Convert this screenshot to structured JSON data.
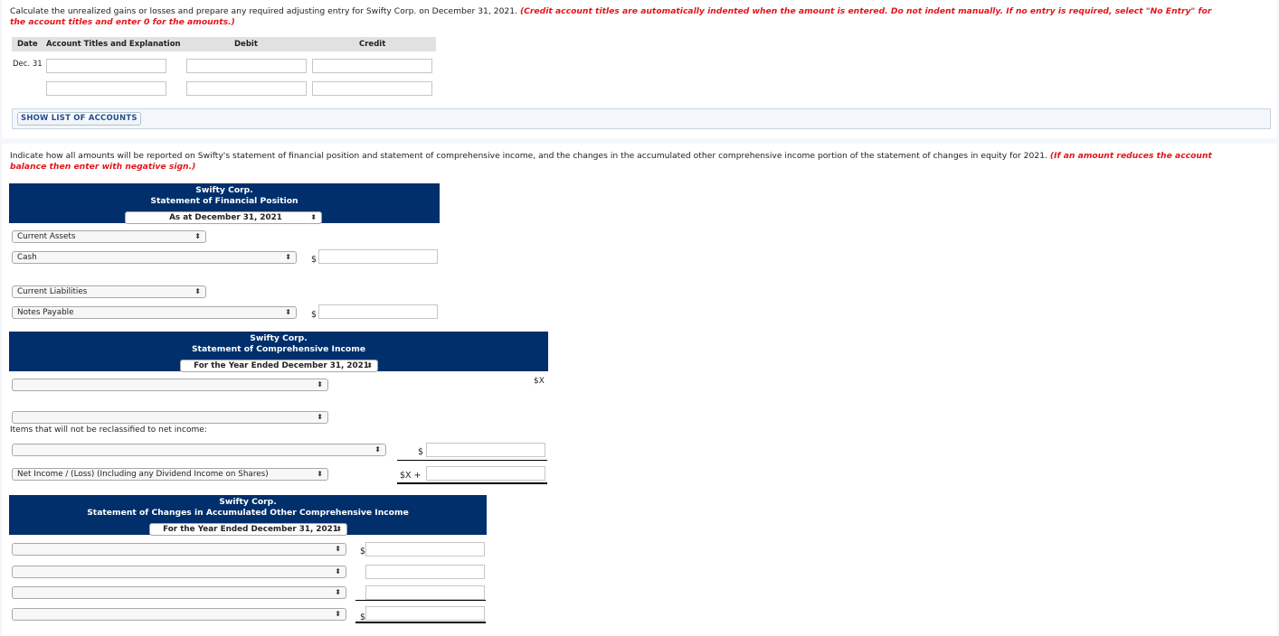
{
  "part1": {
    "instruction": "Calculate the unrealized gains or losses and prepare any required adjusting entry for Swifty Corp. on December 31, 2021. ",
    "note_line1": "(Credit account titles are automatically indented when the amount is entered. Do not indent manually. If no entry is required, select \"No Entry\" for",
    "note_line2": "the account titles and enter 0 for the amounts.)",
    "journal": {
      "headers": {
        "date": "Date",
        "account": "Account Titles and Explanation",
        "debit": "Debit",
        "credit": "Credit"
      },
      "rows": [
        {
          "date": "Dec. 31",
          "account": "",
          "debit": "",
          "credit": ""
        },
        {
          "date": "",
          "account": "",
          "debit": "",
          "credit": ""
        }
      ]
    },
    "show_accounts_label": "SHOW LIST OF ACCOUNTS"
  },
  "part2": {
    "instruction": "Indicate how all amounts will be reported on Swifty's statement of financial position and statement of comprehensive income, and the changes in the accumulated other comprehensive income portion of the statement of changes in equity for 2021. ",
    "note_line1": "(If an amount reduces the account",
    "note_line2": "balance then enter with negative sign.)",
    "sfp": {
      "company": "Swifty Corp.",
      "title": "Statement of Financial Position",
      "period": "As at December 31, 2021",
      "rows": [
        {
          "label": "Current Assets"
        },
        {
          "label": "Cash",
          "currency": "$",
          "amount": ""
        },
        {
          "label": "Current Liabilities"
        },
        {
          "label": "Notes Payable",
          "currency": "$",
          "amount": ""
        }
      ]
    },
    "sci": {
      "company": "Swifty Corp.",
      "title": "Statement of Comprehensive Income",
      "period": "For the Year Ended December 31, 2021",
      "row1": {
        "label": "",
        "value": "$X"
      },
      "row2": {
        "label": ""
      },
      "section_label": "Items that will not be reclassified to net income:",
      "row3": {
        "label": "",
        "currency": "$",
        "amount": ""
      },
      "row4": {
        "label": "Net Income / (Loss) (Including any Dividend Income on Shares)",
        "prefix": "$X +",
        "amount": ""
      }
    },
    "aoci": {
      "company": "Swifty Corp.",
      "title": "Statement of Changes in Accumulated Other Comprehensive Income",
      "period": "For the Year Ended December 31, 2021",
      "rows": [
        {
          "label": "",
          "currency": "$",
          "amount": ""
        },
        {
          "label": "",
          "currency": "",
          "amount": ""
        },
        {
          "label": "",
          "currency": "",
          "amount": ""
        },
        {
          "label": "",
          "currency": "$",
          "amount": ""
        }
      ]
    }
  },
  "icons": {
    "select_arrow": "⬍"
  }
}
